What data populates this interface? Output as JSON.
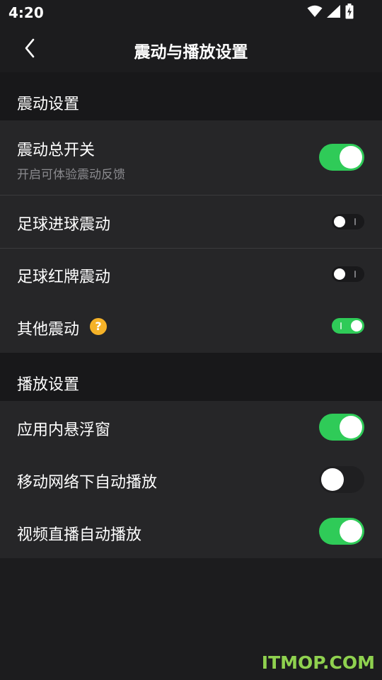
{
  "status_bar": {
    "time": "4:20",
    "icons": [
      "wifi-icon",
      "cell-signal-icon",
      "battery-charging-icon"
    ]
  },
  "nav": {
    "back_icon": "chevron-left-icon",
    "title": "震动与播放设置"
  },
  "vibration_section": {
    "header": "震动设置",
    "master_switch": {
      "label": "震动总开关",
      "subtitle": "开启可体验震动反馈",
      "on": true
    },
    "goal_vibration": {
      "label": "足球进球震动",
      "on": false
    },
    "red_card_vibration": {
      "label": "足球红牌震动",
      "on": false
    },
    "other_vibration": {
      "label": "其他震动",
      "help": "?",
      "on": true
    }
  },
  "playback_section": {
    "header": "播放设置",
    "floating_window": {
      "label": "应用内悬浮窗",
      "on": true
    },
    "mobile_autoplay": {
      "label": "移动网络下自动播放",
      "on": false
    },
    "live_autoplay": {
      "label": "视频直播自动播放",
      "on": true
    }
  },
  "watermark": "ITMOP.COM",
  "colors": {
    "accent_green": "#2fcb58",
    "background": "#1c1c1e",
    "row_background": "#262628",
    "help_badge": "#f5b228"
  }
}
